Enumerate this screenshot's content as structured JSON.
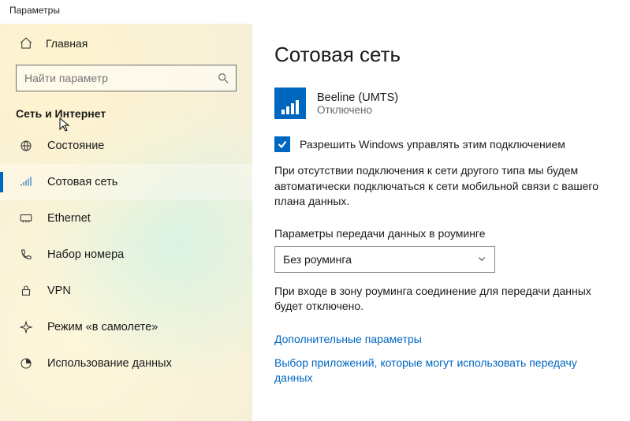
{
  "titlebar": "Параметры",
  "sidebar": {
    "home": "Главная",
    "search_placeholder": "Найти параметр",
    "section": "Сеть и Интернет",
    "items": [
      {
        "label": "Состояние"
      },
      {
        "label": "Сотовая сеть"
      },
      {
        "label": "Ethernet"
      },
      {
        "label": "Набор номера"
      },
      {
        "label": "VPN"
      },
      {
        "label": "Режим «в самолете»"
      },
      {
        "label": "Использование данных"
      }
    ]
  },
  "main": {
    "heading": "Сотовая сеть",
    "network": {
      "name": "Beeline (UMTS)",
      "status": "Отключено"
    },
    "allow_label": "Разрешить Windows управлять этим подключением",
    "allow_desc": "При отсутствии подключения к сети другого типа мы будем автоматически подключаться к сети мобильной связи с вашего плана данных.",
    "roaming_label": "Параметры передачи данных в роуминге",
    "roaming_value": "Без роуминга",
    "roaming_desc": "При входе в зону роуминга соединение для передачи данных будет отключено.",
    "link_advanced": "Дополнительные параметры",
    "link_apps": "Выбор приложений, которые могут использовать передачу данных"
  }
}
